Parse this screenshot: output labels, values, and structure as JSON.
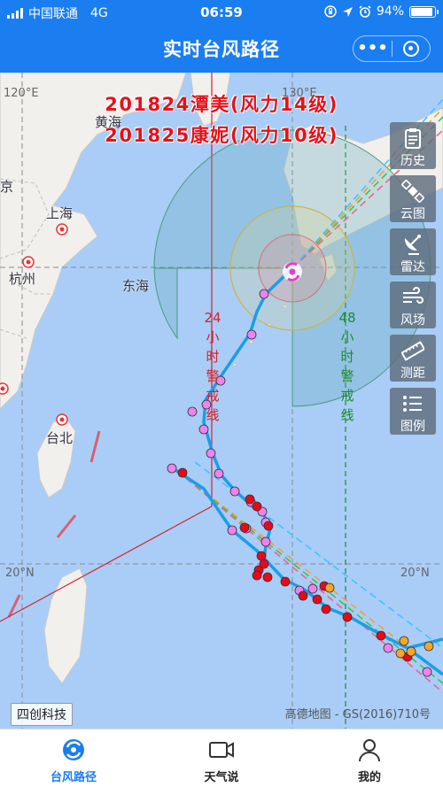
{
  "status_bar": {
    "carrier": "中国联通",
    "network": "4G",
    "time": "06:59",
    "battery": "94%"
  },
  "titlebar": {
    "title": "实时台风路径",
    "more_label": "•••"
  },
  "map": {
    "headline_1": "201824潭美(风力14级)",
    "headline_2": "201825康妮(风力10级)",
    "places": [
      "黄海",
      "东海",
      "上海",
      "杭州",
      "台北",
      "京"
    ],
    "coords": [
      "120°E",
      "130°E",
      "20°N",
      "20°N"
    ],
    "warning_24": [
      "24",
      "小",
      "时",
      "警",
      "戒",
      "线"
    ],
    "warning_48": [
      "48",
      "小",
      "时",
      "警",
      "戒",
      "线"
    ],
    "brand": "四创科技",
    "copyright": "高德地图 - GS(2016)710号",
    "colors": {
      "sea": "#a9cdf7",
      "land": "#f1f0ed",
      "warning_24": "#d8202a",
      "warning_48": "#1c8b2a",
      "track": "#1a9ee8",
      "point_pink": "#ee82ee",
      "point_red": "#e8091a",
      "point_orange": "#f5a623"
    }
  },
  "tools": [
    {
      "label": "历史",
      "icon": "clipboard-icon"
    },
    {
      "label": "云图",
      "icon": "satellite-icon"
    },
    {
      "label": "雷达",
      "icon": "radar-dish-icon"
    },
    {
      "label": "风场",
      "icon": "wind-icon"
    },
    {
      "label": "测距",
      "icon": "ruler-icon"
    },
    {
      "label": "图例",
      "icon": "list-icon"
    }
  ],
  "tabs": [
    {
      "label": "台风路径",
      "icon": "typhoon-icon",
      "active": true,
      "color": "#1a7df0"
    },
    {
      "label": "天气说",
      "icon": "video-camera-icon",
      "active": false,
      "color": "#222222"
    },
    {
      "label": "我的",
      "icon": "user-icon",
      "active": false,
      "color": "#222222"
    }
  ]
}
